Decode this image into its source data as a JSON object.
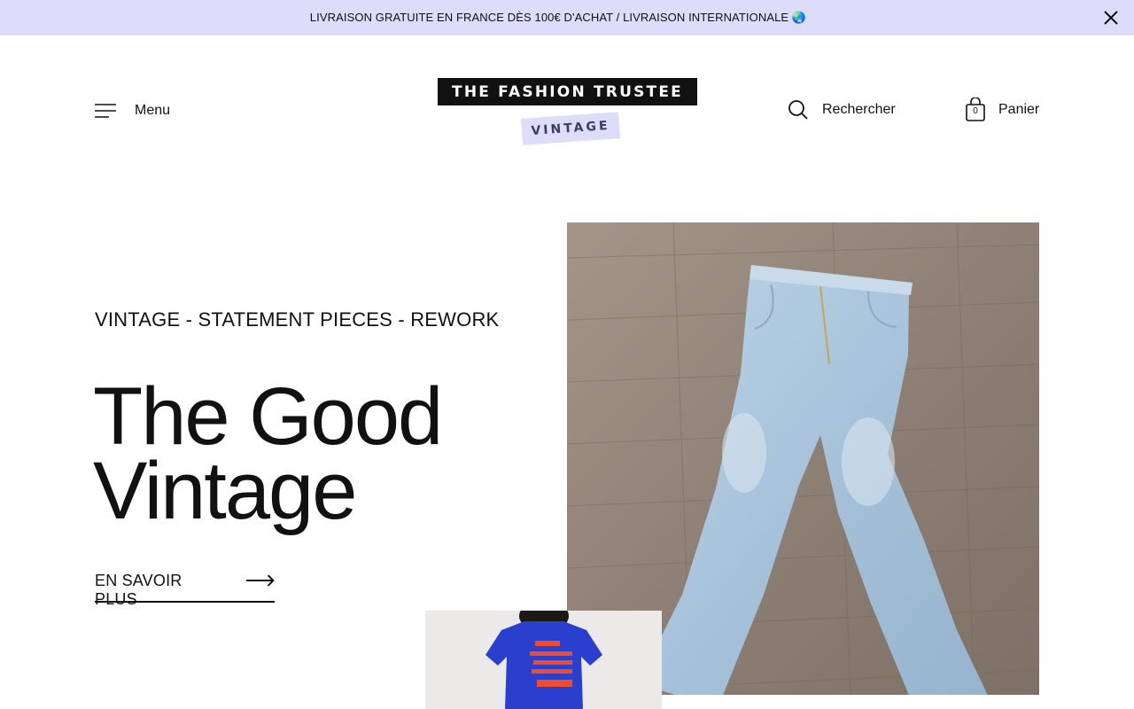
{
  "announcement": {
    "text": "LIVRAISON GRATUITE EN FRANCE DÈS 100€ D'ACHAT / LIVRAISON INTERNATIONALE 🌏",
    "close_icon": "close-icon"
  },
  "header": {
    "menu_label": "Menu",
    "menu_icon": "hamburger-icon",
    "logo_top": "THE FASHION TRUSTEE",
    "logo_bottom": "VINTAGE",
    "search_label": "Rechercher",
    "search_icon": "search-icon",
    "cart_label": "Panier",
    "cart_icon": "shopping-bag-icon",
    "cart_count": "0"
  },
  "hero": {
    "tagline": "VINTAGE - STATEMENT PIECES - REWORK",
    "title_line1": "The Good",
    "title_line2": "Vintage",
    "cta_label": "EN SAVOIR PLUS",
    "cta_icon": "arrow-right-icon"
  },
  "colors": {
    "announcement_bg": "#dddcfb",
    "text": "#111111",
    "logo_accent": "#dddcfb"
  }
}
